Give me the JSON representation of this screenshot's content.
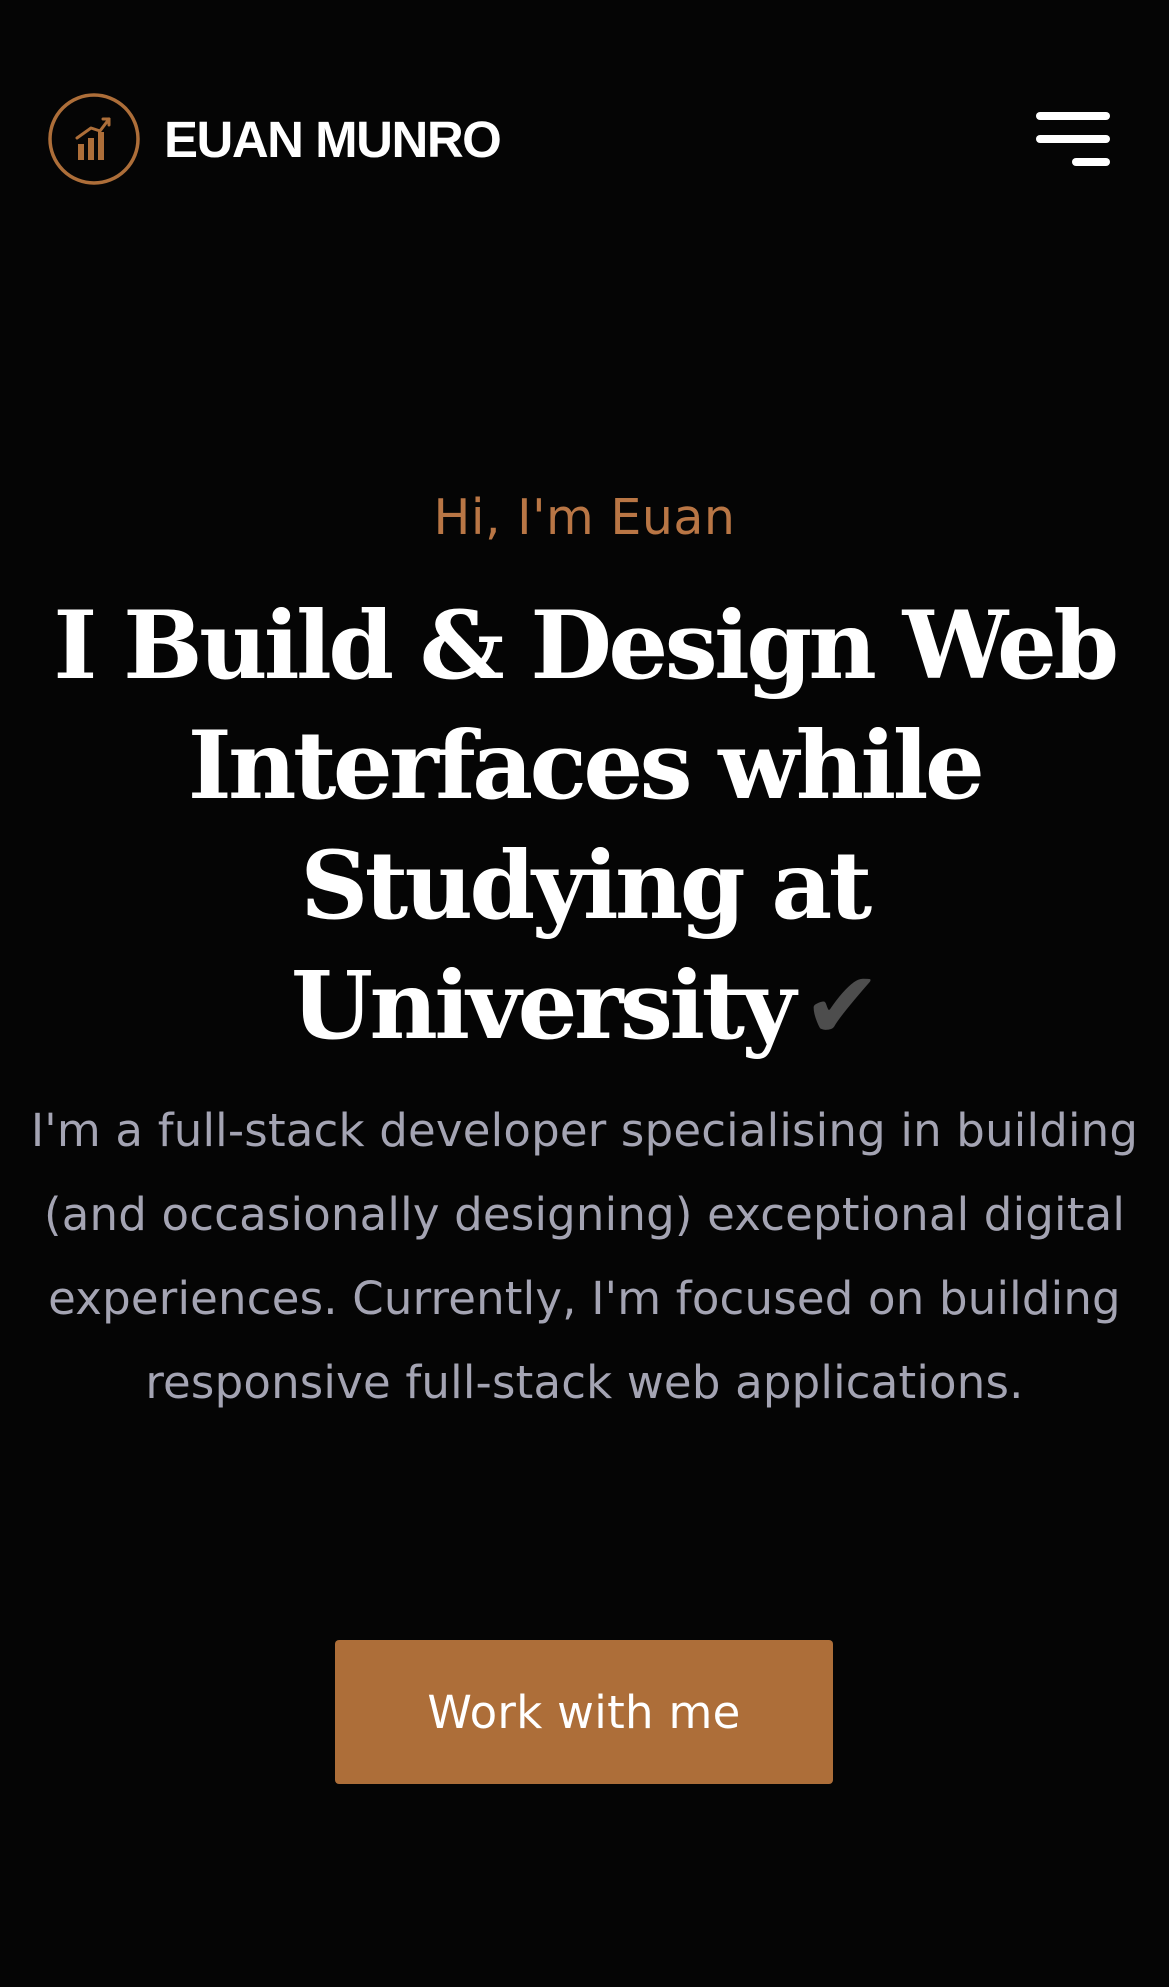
{
  "header": {
    "logo_text": "EUAN MUNRO",
    "logo_icon": "bar-chart-circle-icon",
    "menu_icon": "hamburger-menu-icon"
  },
  "hero": {
    "greeting": "Hi, I'm Euan",
    "headline": "I Build & Design Web Interfaces while Studying at University",
    "headline_emoji": "✔",
    "intro": "I'm a full-stack developer specialising in building (and occasionally designing) exceptional digital experiences. Currently, I'm focused on building responsive full-stack web applications.",
    "cta_label": "Work with me"
  },
  "colors": {
    "background": "#050505",
    "accent": "#ad6e39",
    "greeting": "#b97645",
    "body_text": "#a4a4b3",
    "heading_text": "#ffffff"
  }
}
